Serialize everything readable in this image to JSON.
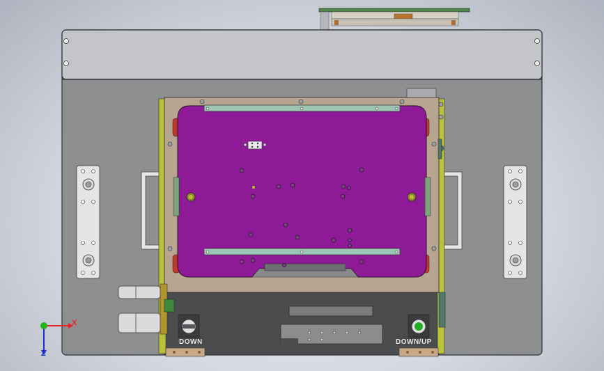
{
  "viewport": {
    "background_top": "#e9ecf2",
    "background_edge": "#aeb4bf"
  },
  "model": {
    "panel_color": "#8d8f90",
    "top_cover_color": "#c3c5c8",
    "fixture_plate_color": "#8f1a98",
    "frame_color": "#b8a590",
    "accent_green": "#b9c23a",
    "rail_color": "#9cc7b4",
    "switch_left_label": "DOWN",
    "switch_right_label": "DOWN/UP"
  },
  "triad": {
    "x_label": "X",
    "y_label": "",
    "z_label": "Z",
    "x_color": "#e0262b",
    "y_color": "#1db61d",
    "z_color": "#1a2fd3"
  }
}
